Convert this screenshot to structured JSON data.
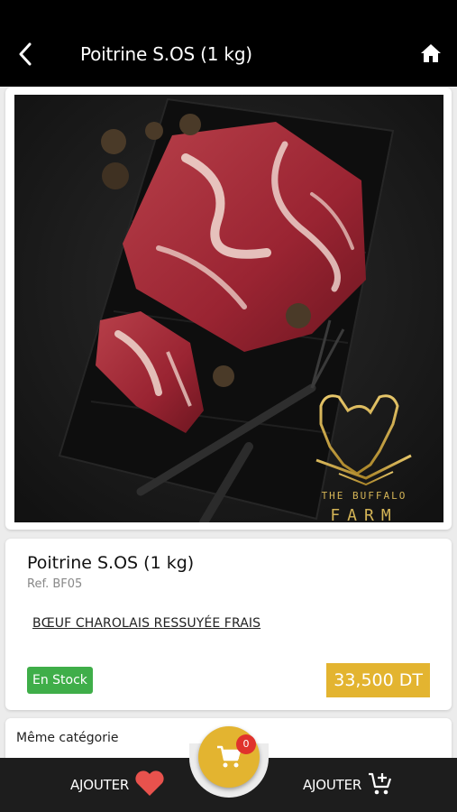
{
  "header": {
    "title": "Poitrine S.OS (1 kg)",
    "back_icon": "chevron-left-icon",
    "home_icon": "home-icon"
  },
  "product": {
    "name": "Poitrine S.OS (1 kg)",
    "ref": "Ref. BF05",
    "description": "BŒUF CHAROLAIS RESSUYÉE FRAIS",
    "stock": "En Stock",
    "price": "33,500 DT",
    "image_logo_text_top": "THE BUFFALO",
    "image_logo_text_bottom": "FARM"
  },
  "related": {
    "title": "Même catégorie"
  },
  "bottom_bar": {
    "wishlist_label": "AJOUTER",
    "wishlist_icon": "heart-icon",
    "cart_label": "AJOUTER",
    "cart_icon": "add-cart-icon",
    "cart_count": "0"
  },
  "colors": {
    "header_bg": "#000000",
    "accent_gold": "#e3b430",
    "stock_green": "#3fae49",
    "badge_red": "#e0322c",
    "heart_red": "#e8524d"
  }
}
